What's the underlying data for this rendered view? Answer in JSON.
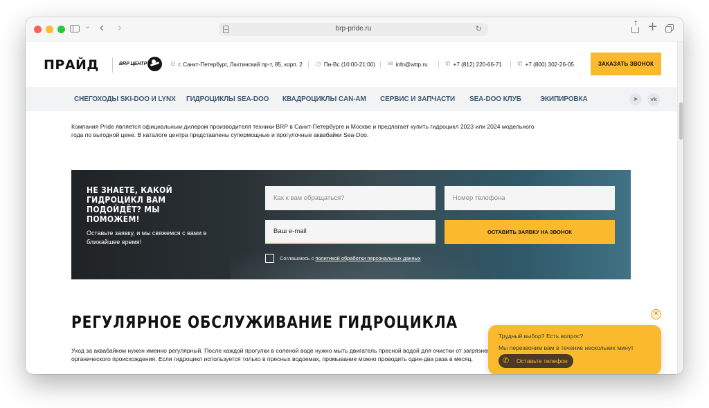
{
  "browser": {
    "url": "brp-pride.ru"
  },
  "header": {
    "logo_text": "ПРАЙД",
    "brp_label": "BRP ЦЕНТР",
    "address": "г. Санкт-Петербург, Лахтинский пр-т, 85, корп. 2",
    "hours": "Пн-Вс (10:00-21:00)",
    "email": "info@wttp.ru",
    "phone1": "+7 (812) 220-66-71",
    "phone2": "+7 (800) 302-26-05",
    "cta": "ЗАКАЗАТЬ ЗВОНОК"
  },
  "nav": {
    "items": [
      "СНЕГОХОДЫ SKI-DOO И LYNX",
      "ГИДРОЦИКЛЫ SEA-DOO",
      "КВАДРОЦИКЛЫ CAN-AM",
      "СЕРВИС И ЗАПЧАСТИ",
      "SEA-DOO КЛУБ",
      "ЭКИПИРОВКА"
    ],
    "social": [
      "telegram-icon",
      "vk-icon"
    ]
  },
  "intro": "Компания Pride является официальным дилером производителя техники BRP в Санкт-Петербурге и Москве и предлагает купить гидроцикл 2023 или 2024 модельного года по выгодной цене. В каталоге центра представлены супермощные и прогулочные аквабайки Sea-Doo.",
  "lead_form": {
    "title": "НЕ ЗНАЕТЕ, КАКОЙ ГИДРОЦИКЛ ВАМ ПОДОЙДЁТ? МЫ ПОМОЖЕМ!",
    "subtitle": "Оставьте заявку, и мы свяжемся с вами в ближайшее время!",
    "name_placeholder": "Как к вам обращаться?",
    "phone_placeholder": "Номер телефона",
    "email_placeholder": "Ваш e-mail",
    "submit": "ОСТАВИТЬ ЗАЯВКУ НА ЗВОНОК",
    "consent_prefix": "Соглашаюсь с ",
    "consent_link": "политикой обработки персональных данных"
  },
  "section": {
    "heading": "РЕГУЛЯРНОЕ ОБСЛУЖИВАНИЕ ГИДРОЦИКЛА",
    "text": "Уход за аквабайком нужен именно регулярный. После каждой прогулки в соленой воде нужно мыть двигатель пресной водой для очистки от загрязнений и наростов органического происхождения. Если гидроцикл используется только в пресных водоемах, промывание можно проводить один-два раза в месяц."
  },
  "popup": {
    "line1": "Трудный выбор? Есть вопрос?",
    "line2": "Мы перезвоним вам в течение нескольких минут",
    "button": "Оставьте телефон"
  },
  "colors": {
    "accent": "#fbb92d",
    "nav_text": "#3f5870"
  }
}
